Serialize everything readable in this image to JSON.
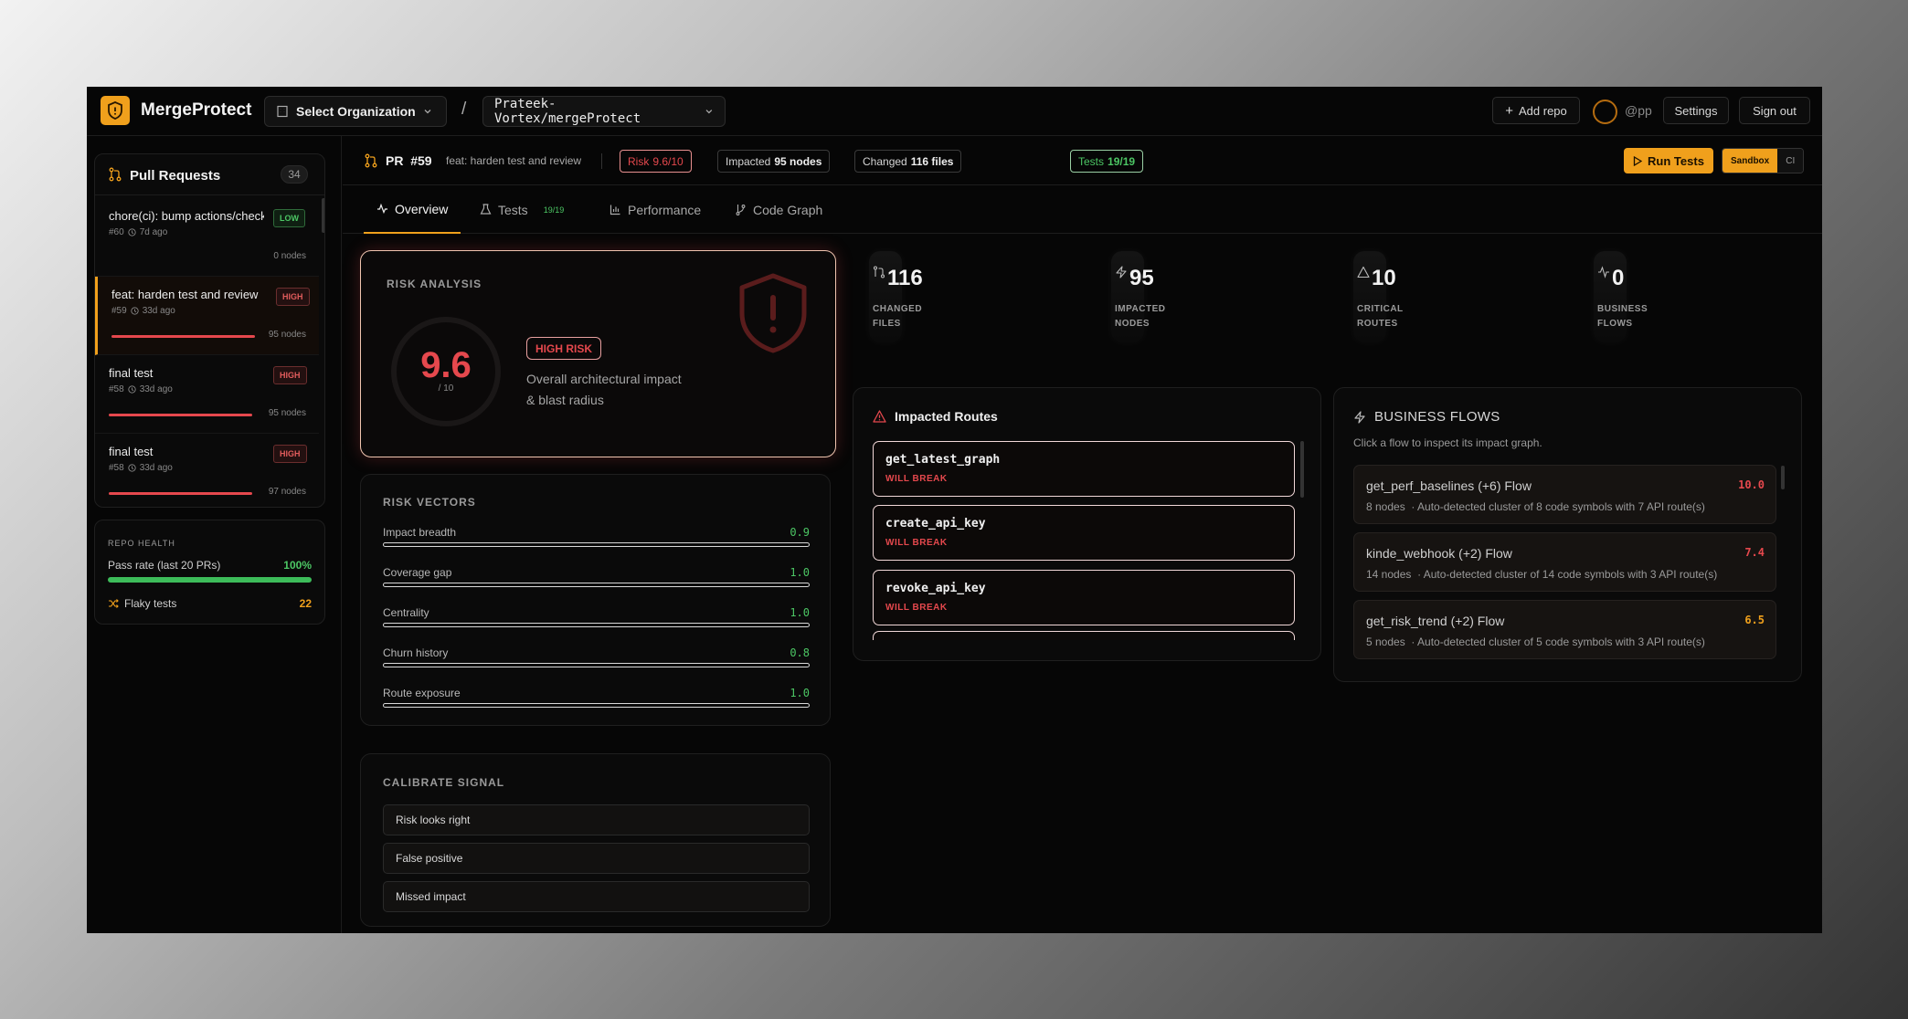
{
  "app": {
    "brand": "MergeProtect",
    "org_select": "Select Organization",
    "repo_select": "Prateek-Vortex/mergeProtect",
    "separator": "/"
  },
  "topbar": {
    "add_repo": "Add repo",
    "handle": "@pp",
    "settings": "Settings",
    "sign_out": "Sign out"
  },
  "sidebar": {
    "title": "Pull Requests",
    "count": "34",
    "items": [
      {
        "title": "chore(ci): bump actions/checkout",
        "number": "#60",
        "age": "7d ago",
        "severity": "LOW",
        "nodes": "0 nodes",
        "has_bar": false
      },
      {
        "title": "feat: harden test and review",
        "number": "#59",
        "age": "33d ago",
        "severity": "HIGH",
        "nodes": "95 nodes",
        "has_bar": true
      },
      {
        "title": "final test",
        "number": "#58",
        "age": "33d ago",
        "severity": "HIGH",
        "nodes": "95 nodes",
        "has_bar": true
      },
      {
        "title": "final test",
        "number": "#58",
        "age": "33d ago",
        "severity": "HIGH",
        "nodes": "97 nodes",
        "has_bar": true
      }
    ],
    "health": {
      "label": "REPO HEALTH",
      "pass_label": "Pass rate (last 20 PRs)",
      "pass_value": "100%",
      "pass_fraction": 1.0,
      "flaky_label": "Flaky tests",
      "flaky_value": "22"
    }
  },
  "pr_header": {
    "pr_label": "PR",
    "number": "#59",
    "title": "feat: harden test and review",
    "risk_label": "Risk",
    "risk_value": "9.6/10",
    "impacted_label": "Impacted",
    "impacted_value": "95 nodes",
    "changed_label": "Changed",
    "changed_value": "116 files",
    "tests_label": "Tests",
    "tests_value": "19/19",
    "run_tests": "Run Tests",
    "mode_sandbox": "Sandbox",
    "mode_ci": "CI"
  },
  "tabs": [
    {
      "label": "Overview",
      "badge": ""
    },
    {
      "label": "Tests",
      "badge": "19/19"
    },
    {
      "label": "Performance",
      "badge": ""
    },
    {
      "label": "Code Graph",
      "badge": ""
    }
  ],
  "risk": {
    "label": "RISK ANALYSIS",
    "score": "9.6",
    "denominator": "/ 10",
    "badge": "HIGH RISK",
    "description": "Overall architectural impact & blast radius"
  },
  "vectors": {
    "label": "RISK VECTORS",
    "items": [
      {
        "name": "Impact breadth",
        "value": "0.9"
      },
      {
        "name": "Coverage gap",
        "value": "1.0"
      },
      {
        "name": "Centrality",
        "value": "1.0"
      },
      {
        "name": "Churn history",
        "value": "0.8"
      },
      {
        "name": "Route exposure",
        "value": "1.0"
      }
    ]
  },
  "calibrate": {
    "label": "CALIBRATE SIGNAL",
    "options": [
      "Risk looks right",
      "False positive",
      "Missed impact"
    ]
  },
  "stats": [
    {
      "value": "116",
      "caption": "CHANGED FILES",
      "icon": "git-compare-icon"
    },
    {
      "value": "95",
      "caption": "IMPACTED NODES",
      "icon": "zap-icon"
    },
    {
      "value": "10",
      "caption": "CRITICAL ROUTES",
      "icon": "warning-icon"
    },
    {
      "value": "0",
      "caption": "BUSINESS FLOWS",
      "icon": "activity-icon"
    }
  ],
  "routes": {
    "title": "Impacted Routes",
    "items": [
      {
        "name": "get_latest_graph",
        "status": "WILL BREAK"
      },
      {
        "name": "create_api_key",
        "status": "WILL BREAK"
      },
      {
        "name": "revoke_api_key",
        "status": "WILL BREAK"
      }
    ]
  },
  "flows": {
    "title": "BUSINESS FLOWS",
    "subtitle": "Click a flow to inspect its impact graph.",
    "items": [
      {
        "name": "get_perf_baselines (+6) Flow",
        "score": "10.0",
        "color": "#e5484d",
        "nodes": "8 nodes",
        "desc": "· Auto-detected cluster of 8 code symbols with 7 API route(s)"
      },
      {
        "name": "kinde_webhook (+2) Flow",
        "score": "7.4",
        "color": "#e5484d",
        "nodes": "14 nodes",
        "desc": "· Auto-detected cluster of 14 code symbols with 3 API route(s)"
      },
      {
        "name": "get_risk_trend (+2) Flow",
        "score": "6.5",
        "color": "#f0a01c",
        "nodes": "5 nodes",
        "desc": "· Auto-detected cluster of 5 code symbols with 3 API route(s)"
      }
    ]
  },
  "colors": {
    "accent": "#f0a01c",
    "danger": "#e5484d",
    "success": "#4cc664",
    "background": "#060606"
  }
}
